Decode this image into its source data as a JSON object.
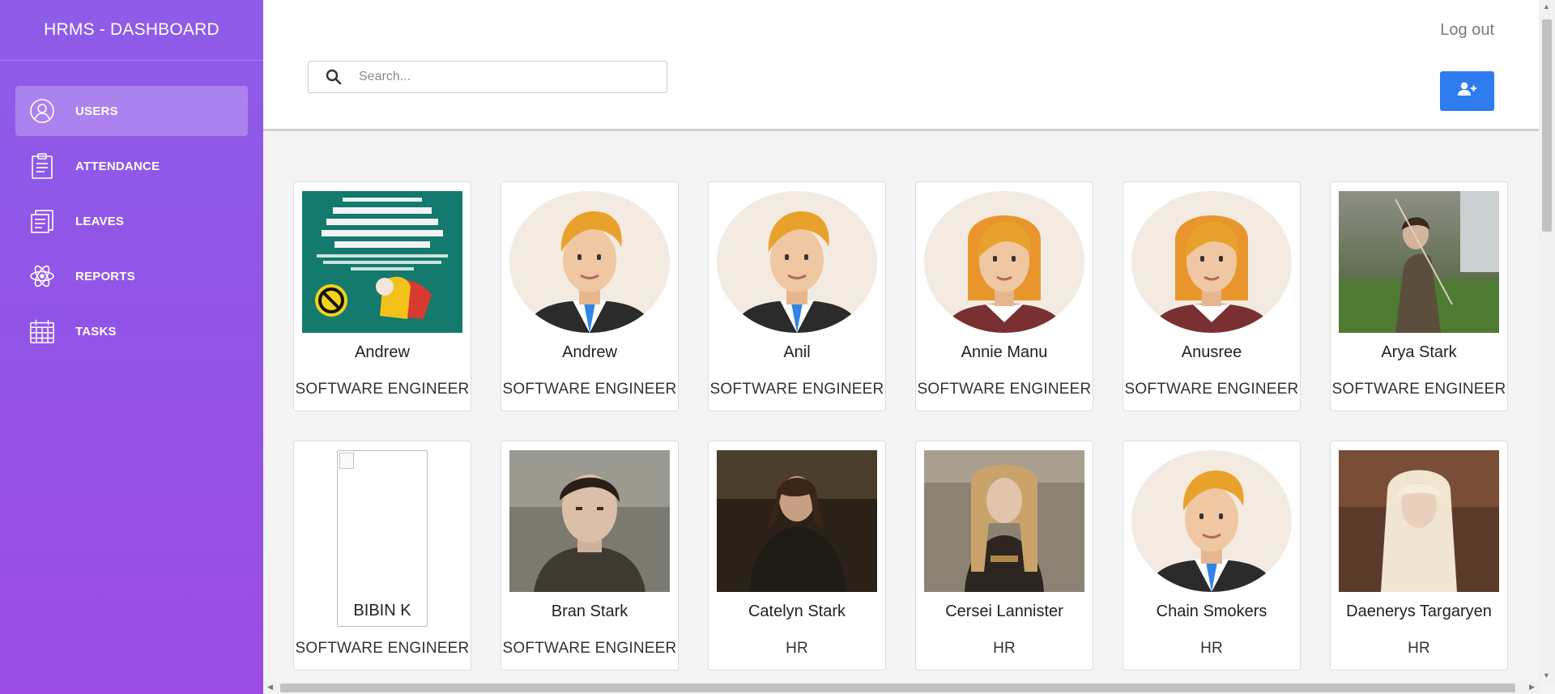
{
  "brand": "HRMS - DASHBOARD",
  "nav": [
    {
      "label": "USERS",
      "icon": "user-icon",
      "active": true
    },
    {
      "label": "ATTENDANCE",
      "icon": "clipboard-icon"
    },
    {
      "label": "LEAVES",
      "icon": "documents-icon"
    },
    {
      "label": "REPORTS",
      "icon": "atom-icon"
    },
    {
      "label": "TASKS",
      "icon": "calendar-icon"
    }
  ],
  "header": {
    "search_placeholder": "Search...",
    "logout": "Log out",
    "add_user_icon": "add-user-icon"
  },
  "users": [
    {
      "name": "Andrew",
      "role": "SOFTWARE ENGINEER",
      "photo": "poster-image"
    },
    {
      "name": "Andrew",
      "role": "SOFTWARE ENGINEER",
      "photo": "male-avatar"
    },
    {
      "name": "Anil",
      "role": "SOFTWARE ENGINEER",
      "photo": "male-avatar"
    },
    {
      "name": "Annie Manu",
      "role": "SOFTWARE ENGINEER",
      "photo": "female-avatar"
    },
    {
      "name": "Anusree",
      "role": "SOFTWARE ENGINEER",
      "photo": "female-avatar"
    },
    {
      "name": "Arya Stark",
      "role": "SOFTWARE ENGINEER",
      "photo": "photo"
    },
    {
      "name": "BIBIN K",
      "role": "SOFTWARE ENGINEER",
      "photo": "broken-image"
    },
    {
      "name": "Bran Stark",
      "role": "SOFTWARE ENGINEER",
      "photo": "photo"
    },
    {
      "name": "Catelyn Stark",
      "role": "HR",
      "photo": "photo"
    },
    {
      "name": "Cersei Lannister",
      "role": "HR",
      "photo": "photo"
    },
    {
      "name": "Chain Smokers",
      "role": "HR",
      "photo": "male-avatar"
    },
    {
      "name": "Daenerys Targaryen",
      "role": "HR",
      "photo": "photo"
    }
  ],
  "colors": {
    "sidebar_top": "#8d5ce8",
    "sidebar_bottom": "#9a4be6",
    "accent_button": "#2f7cf0"
  }
}
